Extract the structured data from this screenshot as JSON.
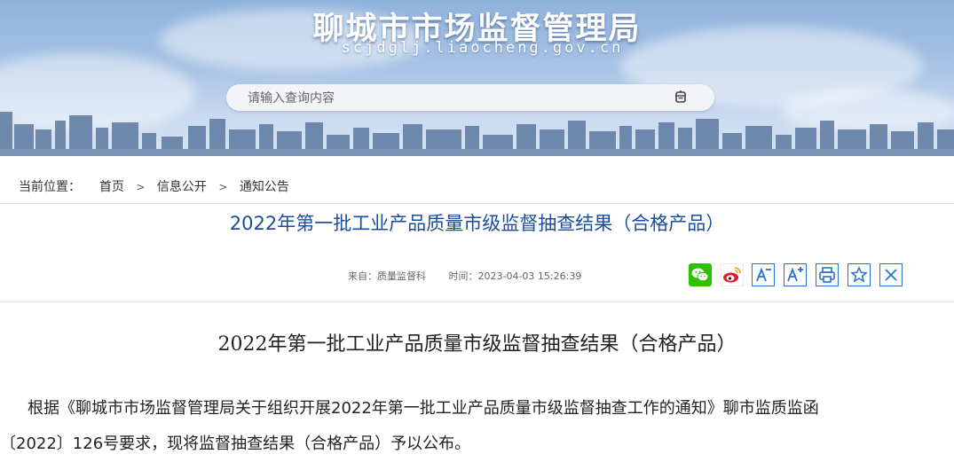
{
  "banner": {
    "title": "聊城市市场监督管理局",
    "domain": "scjdglj.liaocheng.gov.cn"
  },
  "search": {
    "placeholder": "请输入查询内容",
    "icon": "search-icon"
  },
  "breadcrumb": {
    "label": "当前位置：",
    "items": [
      "首页",
      "信息公开",
      "通知公告"
    ],
    "separator": ">"
  },
  "article": {
    "title": "2022年第一批工业产品质量市级监督抽查结果（合格产品）",
    "source": "来自：质量监督科",
    "time": "时间：2023-04-03 15:26:39",
    "share_tools": [
      {
        "name": "wechat-share-icon",
        "color": "#2dc100"
      },
      {
        "name": "weibo-share-icon",
        "color": "#e6162d"
      },
      {
        "name": "font-decrease-icon",
        "color": "#2a70c7"
      },
      {
        "name": "font-increase-icon",
        "color": "#2a70c7"
      },
      {
        "name": "print-icon",
        "color": "#2a70c7"
      },
      {
        "name": "favorite-star-icon",
        "color": "#2a70c7"
      },
      {
        "name": "close-icon",
        "color": "#2a70c7"
      }
    ]
  },
  "content": {
    "heading": "2022年第一批工业产品质量市级监督抽查结果（合格产品）",
    "paragraph_line1": "根据《聊城市市场监督管理局关于组织开展2022年第一批工业产品质量市级监督抽查工作的通知》聊市监质监函",
    "paragraph_line2": "〔2022〕126号要求，现将监督抽查结果（合格产品）予以公布。"
  },
  "colors": {
    "title_blue": "#1a4d9c",
    "tool_border": "#2a70c7",
    "banner_sky": "#a9c4e6"
  }
}
